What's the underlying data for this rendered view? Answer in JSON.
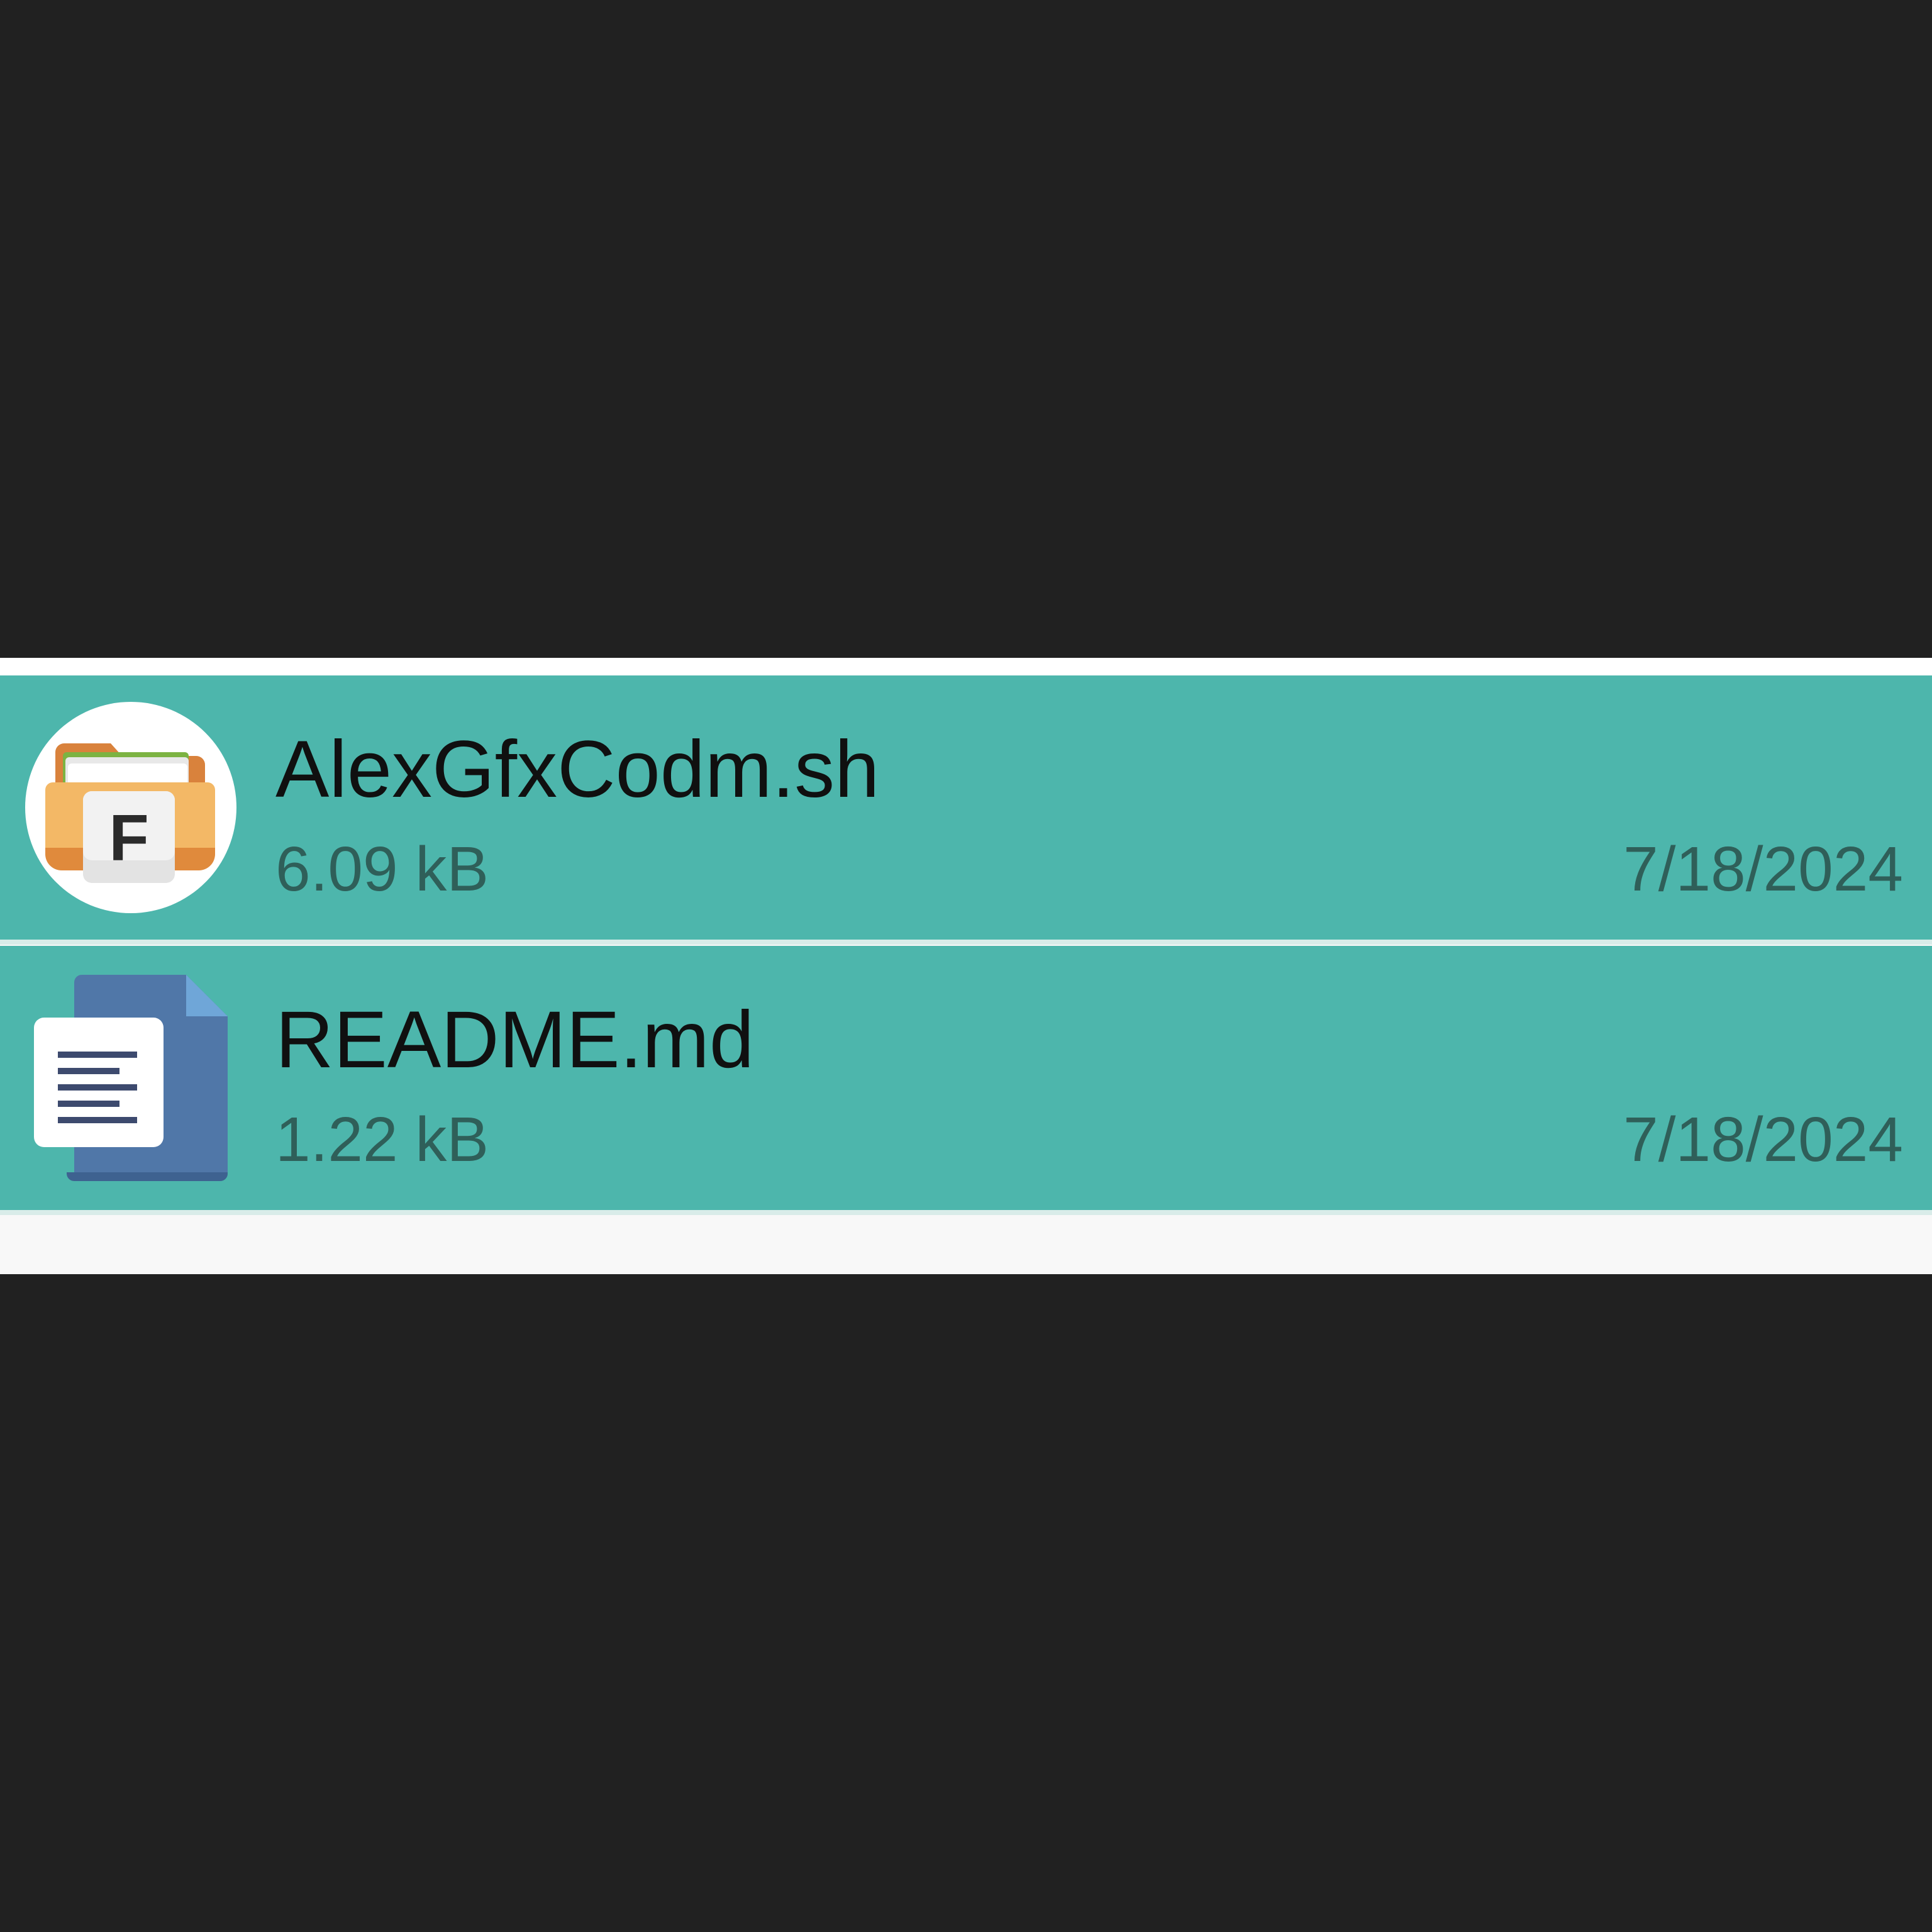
{
  "colors": {
    "background": "#212121",
    "row_selected": "#4db6ac",
    "panel": "#f8f8f8",
    "name_text": "#101010",
    "meta_text": "#2f5f59"
  },
  "files": [
    {
      "name": "AlexGfxCodm.sh",
      "size": "6.09 kB",
      "date": "7/18/2024",
      "icon": "file-manager-app-icon",
      "selected": true
    },
    {
      "name": "README.md",
      "size": "1.22 kB",
      "date": "7/18/2024",
      "icon": "text-document-icon",
      "selected": true
    }
  ],
  "icon_labels": {
    "file_manager_badge": "F"
  }
}
